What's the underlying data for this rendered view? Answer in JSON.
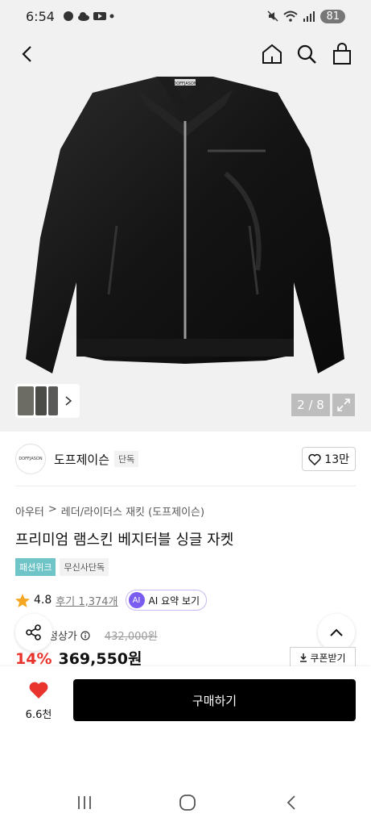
{
  "status_bar": {
    "time": "6:54",
    "battery": "81"
  },
  "nav": {
    "back_icon": "chevron-left-icon",
    "home_icon": "home-icon",
    "search_icon": "search-icon",
    "cart_icon": "shopping-bag-icon"
  },
  "gallery": {
    "counter": "2 / 8",
    "jacket_logo": "DOFFJASON"
  },
  "brand": {
    "logo_text": "DOFFJASON",
    "name": "도프제이슨",
    "tag": "단독",
    "likes": "13만"
  },
  "breadcrumb": [
    "아우터",
    "레더/라이더스 재킷 (도프제이슨)"
  ],
  "product": {
    "title": "프리미엄 램스킨 베지터블 싱글 자켓"
  },
  "tags": {
    "fashion_week": "패션위크",
    "exclusive": "무신사단독"
  },
  "rating": {
    "score": "4.8",
    "reviews": "후기 1,374개",
    "ai_badge": "AI",
    "ai_label": "AI 요약 보기"
  },
  "price": {
    "label": "정상가",
    "original": "432,000원",
    "discount": "14%",
    "sale": "369,550원",
    "coupon": "쿠폰받기"
  },
  "bottom": {
    "wish_count": "6.6천",
    "buy_label": "구매하기"
  },
  "colors": {
    "accent_red": "#e8342d",
    "teal_tag": "#6ec4c6",
    "ai_purple": "#7b5cf0"
  }
}
